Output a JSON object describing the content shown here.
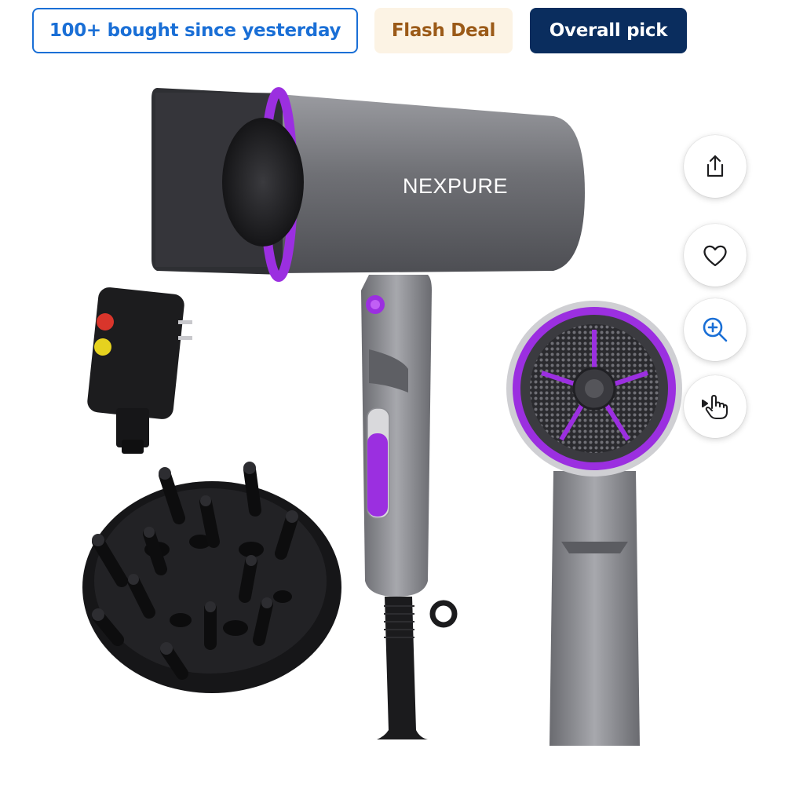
{
  "badges": {
    "bought": "100+ bought since yesterday",
    "flash": "Flash Deal",
    "pick": "Overall pick"
  },
  "product": {
    "brand_logo": "NEXPURE",
    "image_alt": "NEXPURE hair dryer with diffuser and plug adapter"
  },
  "actions": [
    {
      "name": "share",
      "icon": "share-icon"
    },
    {
      "name": "favorite",
      "icon": "heart-icon"
    },
    {
      "name": "zoom",
      "icon": "zoom-in-icon"
    },
    {
      "name": "view-3d",
      "icon": "hand-pointer-icon"
    }
  ],
  "colors": {
    "accent_blue": "#1a6fd6",
    "navy": "#0a2d5e",
    "flash_bg": "#fcf3e4",
    "flash_text": "#9b5a18",
    "product_purple": "#8a2be2",
    "product_gray": "#7d7e83"
  }
}
